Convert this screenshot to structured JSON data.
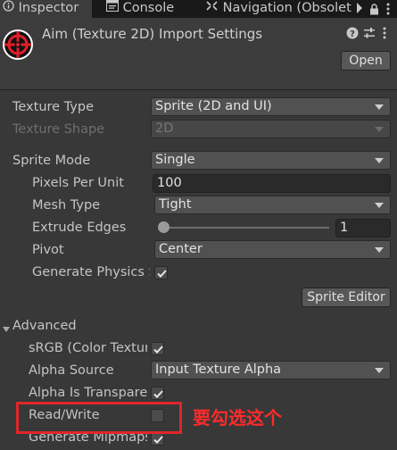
{
  "tabs": [
    {
      "label": "Inspector",
      "icon": "info-icon"
    },
    {
      "label": "Console",
      "icon": "console-icon"
    },
    {
      "label": "Navigation (Obsolet",
      "icon": "navigation-icon"
    }
  ],
  "header": {
    "title": "Aim (Texture 2D) Import Settings",
    "open_label": "Open",
    "icon": "crosshair-icon"
  },
  "settings": {
    "texture_type": {
      "label": "Texture Type",
      "value": "Sprite (2D and UI)"
    },
    "texture_shape": {
      "label": "Texture Shape",
      "value": "2D"
    },
    "sprite_mode": {
      "label": "Sprite Mode",
      "value": "Single"
    },
    "pixels_per_unit": {
      "label": "Pixels Per Unit",
      "value": "100"
    },
    "mesh_type": {
      "label": "Mesh Type",
      "value": "Tight"
    },
    "extrude_edges": {
      "label": "Extrude Edges",
      "value": "1"
    },
    "pivot": {
      "label": "Pivot",
      "value": "Center"
    },
    "generate_physics": {
      "label": "Generate Physics Shape",
      "checked": true
    },
    "sprite_editor_label": "Sprite Editor"
  },
  "advanced": {
    "label": "Advanced",
    "srgb": {
      "label": "sRGB (Color Texture)",
      "checked": true
    },
    "alpha_source": {
      "label": "Alpha Source",
      "value": "Input Texture Alpha"
    },
    "alpha_is_transparency": {
      "label": "Alpha Is Transparency",
      "checked": true
    },
    "read_write": {
      "label": "Read/Write",
      "checked": false
    },
    "generate_mipmaps": {
      "label": "Generate Mipmaps",
      "checked": true
    }
  },
  "annotation": {
    "text": "要勾选这个",
    "color": "#e0262a"
  }
}
